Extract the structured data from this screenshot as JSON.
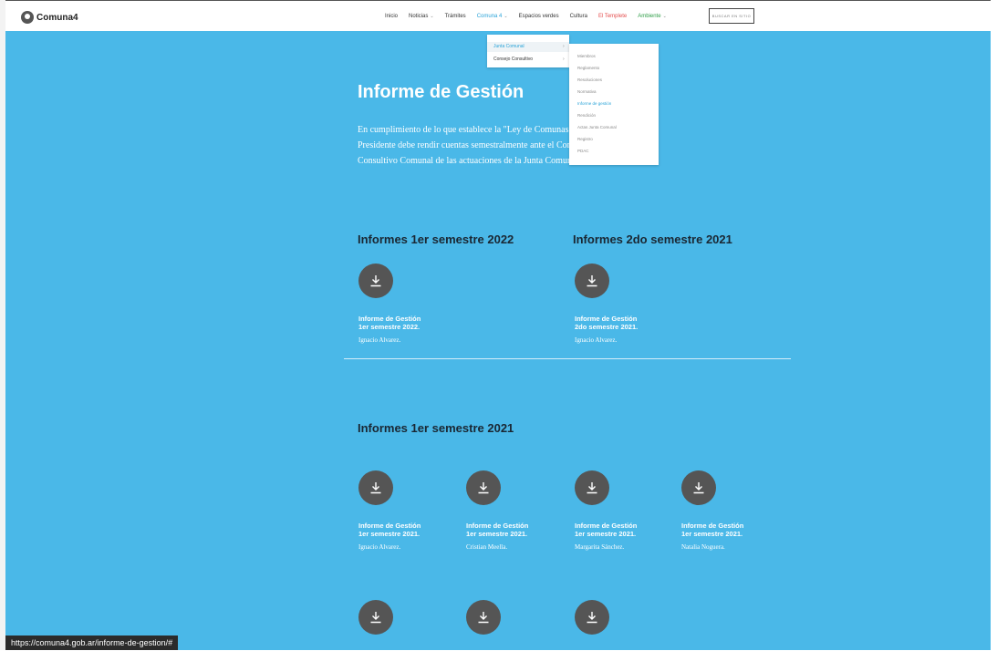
{
  "header": {
    "logo_text": "Comuna4",
    "nav": [
      {
        "label": "Inicio",
        "chevron": false,
        "style": "normal"
      },
      {
        "label": "Noticias",
        "chevron": true,
        "style": "normal"
      },
      {
        "label": "Trámites",
        "chevron": false,
        "style": "normal"
      },
      {
        "label": "Comuna 4",
        "chevron": true,
        "style": "active"
      },
      {
        "label": "Espacios verdes",
        "chevron": false,
        "style": "normal"
      },
      {
        "label": "Cultura",
        "chevron": false,
        "style": "normal"
      },
      {
        "label": "El Templete",
        "chevron": false,
        "style": "red"
      },
      {
        "label": "Ambiente",
        "chevron": true,
        "style": "green"
      }
    ],
    "search_label": "BUSCAR EN SITIO"
  },
  "dropdown": {
    "items": [
      {
        "label": "Junta Comunal",
        "active": true
      },
      {
        "label": "Consejo Consultivo",
        "active": false
      }
    ],
    "chevron": "›"
  },
  "submenu": {
    "items": [
      {
        "label": "Miembros",
        "active": false
      },
      {
        "label": "Reglamento",
        "active": false
      },
      {
        "label": "Resoluciones",
        "active": false
      },
      {
        "label": "Normativa",
        "active": false
      },
      {
        "label": "Informe de gestión",
        "active": true
      },
      {
        "label": "Rendición",
        "active": false
      },
      {
        "label": "Actas Junta Comunal",
        "active": false
      },
      {
        "label": "Registro",
        "active": false
      },
      {
        "label": "PDAC",
        "active": false
      }
    ]
  },
  "page": {
    "title": "Informe de Gestión",
    "intro_lines": [
      "En cumplimiento de lo que establece la \"Ley de Comunas\" el",
      "Presidente debe rendir cuentas semestralmente ante el Consejo",
      "Consultivo Comunal de las actuaciones de la Junta Comunal."
    ]
  },
  "sections": [
    {
      "heading": "Informes 1er semestre 2022"
    },
    {
      "heading": "Informes 2do semestre 2021"
    },
    {
      "heading": "Informes 1er semestre 2021"
    }
  ],
  "cards": [
    {
      "title_line1": "Informe de Gestión",
      "title_line2": "1er semestre 2022.",
      "author": "Ignacio Alvarez."
    },
    {
      "title_line1": "Informe de Gestión",
      "title_line2": "2do semestre 2021.",
      "author": "Ignacio Alvarez."
    },
    {
      "title_line1": "Informe de Gestión",
      "title_line2": "1er semestre 2021.",
      "author": "Ignacio Alvarez."
    },
    {
      "title_line1": "Informe de Gestión",
      "title_line2": "1er semestre 2021.",
      "author": "Cristian Meella."
    },
    {
      "title_line1": "Informe de Gestión",
      "title_line2": "1er semestre 2021.",
      "author": "Margarita Sánchez."
    },
    {
      "title_line1": "Informe de Gestión",
      "title_line2": "1er semestre 2021.",
      "author": "Natalia Noguera."
    }
  ],
  "status_bar": {
    "url": "https://comuna4.gob.ar/informe-de-gestion/#"
  },
  "colors": {
    "background": "#4ab8e8",
    "icon_circle": "#555555",
    "accent": "#2aa3d8"
  },
  "icons": {
    "download": "download-icon",
    "logo": "logo-icon"
  }
}
